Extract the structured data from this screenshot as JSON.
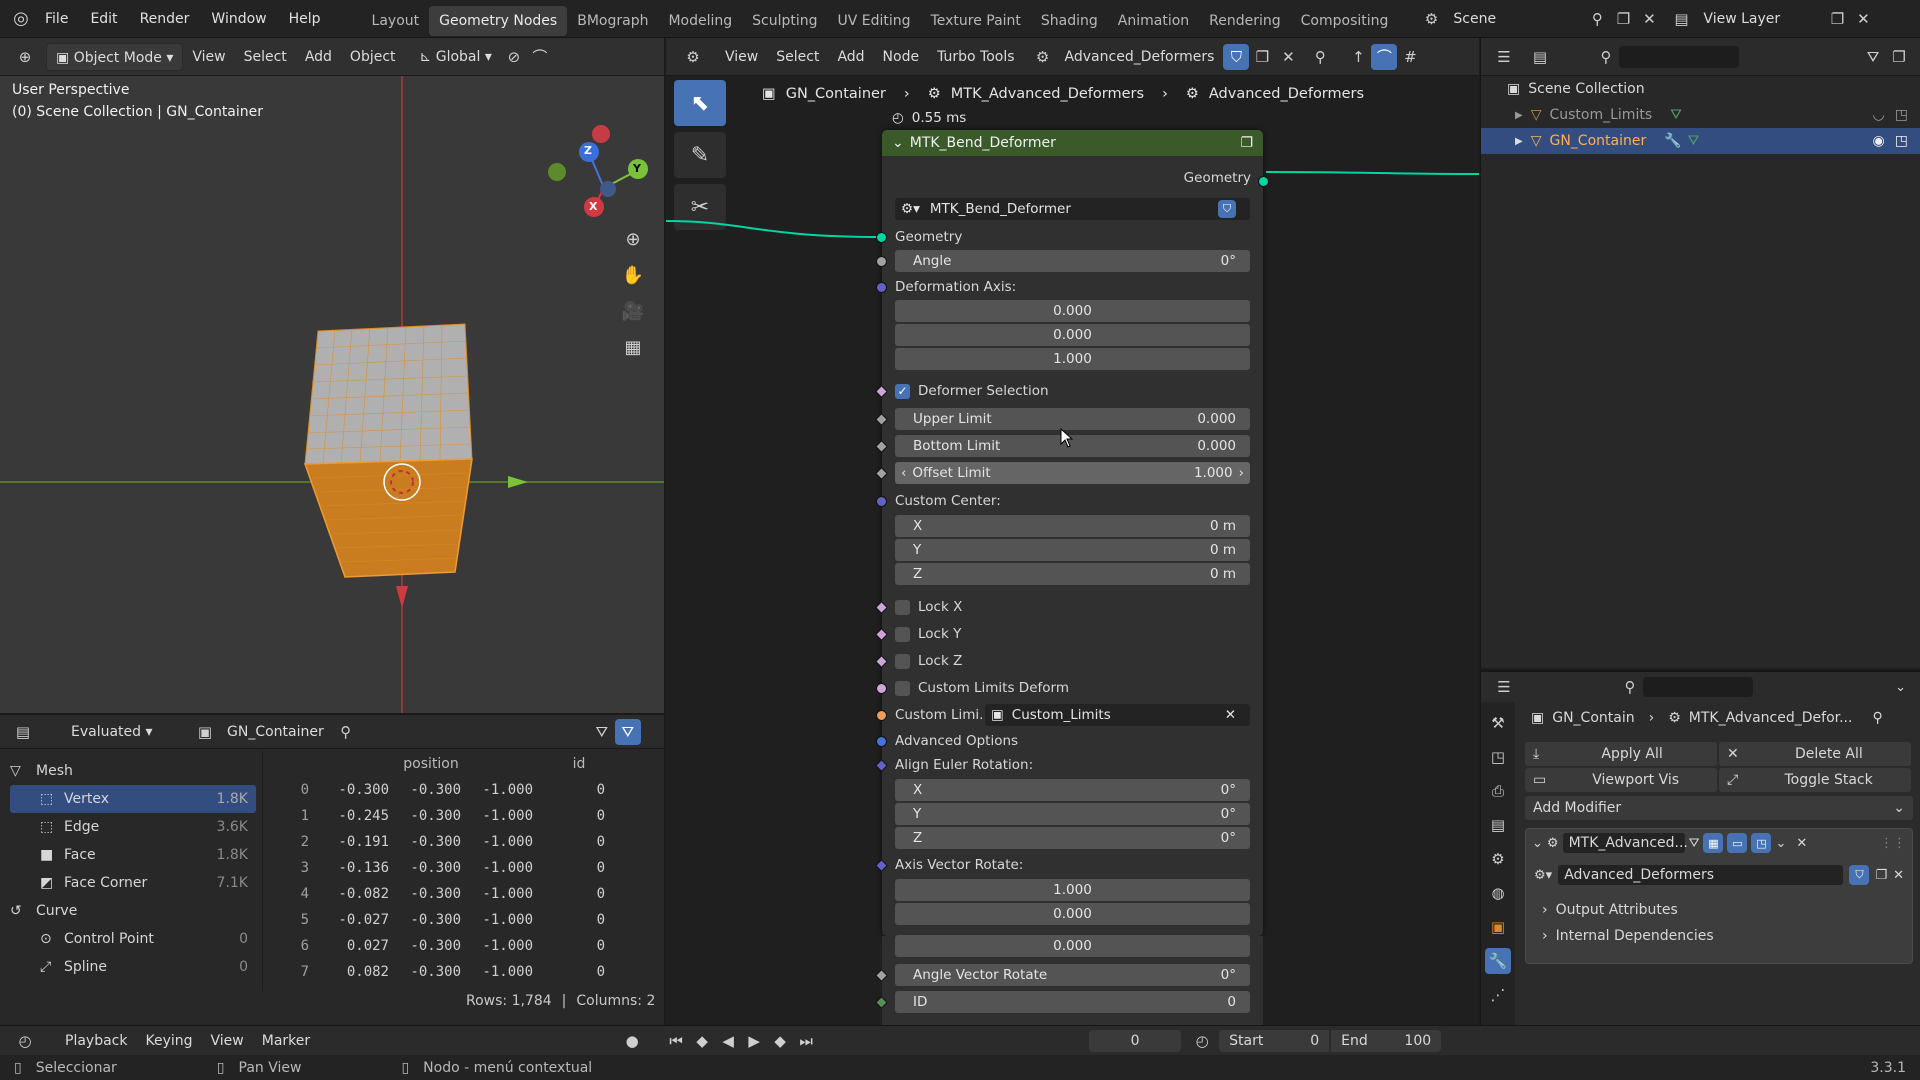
{
  "menu": [
    "File",
    "Edit",
    "Render",
    "Window",
    "Help"
  ],
  "workspaces": [
    "Layout",
    "Geometry Nodes",
    "BMograph",
    "Modeling",
    "Sculpting",
    "UV Editing",
    "Texture Paint",
    "Shading",
    "Animation",
    "Rendering",
    "Compositing"
  ],
  "active_workspace": "Geometry Nodes",
  "scene": "Scene",
  "view_layer": "View Layer",
  "viewport": {
    "mode": "Object Mode",
    "menus": [
      "View",
      "Select",
      "Add",
      "Object"
    ],
    "transform": "Global",
    "title": "User Perspective",
    "subtitle": "(0) Scene Collection | GN_Container",
    "axis_x": "X",
    "axis_y": "Y",
    "axis_z": "Z"
  },
  "node_editor": {
    "menus": [
      "View",
      "Select",
      "Add",
      "Node",
      "Turbo Tools"
    ],
    "node_group": "Advanced_Deformers",
    "breadcrumb": [
      "GN_Container",
      "MTK_Advanced_Deformers",
      "Advanced_Deformers"
    ],
    "timing": "0.55 ms",
    "node_title": "MTK_Bend_Deformer",
    "output_label": "Geometry",
    "group_name": "MTK_Bend_Deformer",
    "geometry": "Geometry",
    "angle_label": "Angle",
    "angle_value": "0°",
    "deform_axis_label": "Deformation Axis:",
    "deform_axis": [
      "0.000",
      "0.000",
      "1.000"
    ],
    "deformer_selection": "Deformer Selection",
    "upper_label": "Upper Limit",
    "upper_value": "0.000",
    "bottom_label": "Bottom Limit",
    "bottom_value": "0.000",
    "offset_label": "Offset Limit",
    "offset_value": "1.000",
    "center_label": "Custom Center:",
    "center": [
      {
        "k": "X",
        "v": "0 m"
      },
      {
        "k": "Y",
        "v": "0 m"
      },
      {
        "k": "Z",
        "v": "0 m"
      }
    ],
    "lock_x": "Lock X",
    "lock_y": "Lock Y",
    "lock_z": "Lock Z",
    "custom_limits_deform": "Custom Limits Deform",
    "custom_limits_label": "Custom Limi...",
    "custom_limits_value": "Custom_Limits",
    "advanced_options": "Advanced Options",
    "align_label": "Align Euler Rotation:",
    "align": [
      {
        "k": "X",
        "v": "0°"
      },
      {
        "k": "Y",
        "v": "0°"
      },
      {
        "k": "Z",
        "v": "0°"
      }
    ],
    "axis_rotate_label": "Axis Vector Rotate:",
    "axis_rotate": [
      "1.000",
      "0.000",
      "0.000"
    ],
    "angle_vector_label": "Angle Vector Rotate",
    "angle_vector_value": "0°",
    "id_label": "ID",
    "id_value": "0"
  },
  "spreadsheet": {
    "mode": "Evaluated",
    "object": "GN_Container",
    "col_position": "position",
    "col_id": "id",
    "tree": [
      {
        "label": "Mesh",
        "count": ""
      },
      {
        "label": "Vertex",
        "count": "1.8K"
      },
      {
        "label": "Edge",
        "count": "3.6K"
      },
      {
        "label": "Face",
        "count": "1.8K"
      },
      {
        "label": "Face Corner",
        "count": "7.1K"
      },
      {
        "label": "Curve",
        "count": ""
      },
      {
        "label": "Control Point",
        "count": "0"
      },
      {
        "label": "Spline",
        "count": "0"
      }
    ],
    "rows": [
      {
        "i": "0",
        "x": "-0.300",
        "y": "-0.300",
        "z": "-1.000",
        "id": "0"
      },
      {
        "i": "1",
        "x": "-0.245",
        "y": "-0.300",
        "z": "-1.000",
        "id": "0"
      },
      {
        "i": "2",
        "x": "-0.191",
        "y": "-0.300",
        "z": "-1.000",
        "id": "0"
      },
      {
        "i": "3",
        "x": "-0.136",
        "y": "-0.300",
        "z": "-1.000",
        "id": "0"
      },
      {
        "i": "4",
        "x": "-0.082",
        "y": "-0.300",
        "z": "-1.000",
        "id": "0"
      },
      {
        "i": "5",
        "x": "-0.027",
        "y": "-0.300",
        "z": "-1.000",
        "id": "0"
      },
      {
        "i": "6",
        "x": "0.027",
        "y": "-0.300",
        "z": "-1.000",
        "id": "0"
      },
      {
        "i": "7",
        "x": "0.082",
        "y": "-0.300",
        "z": "-1.000",
        "id": "0"
      }
    ],
    "footer_rows": "Rows: 1,784",
    "footer_cols": "Columns: 2"
  },
  "outliner": {
    "root": "Scene Collection",
    "items": [
      "Custom_Limits",
      "GN_Container"
    ]
  },
  "properties": {
    "breadcrumb": [
      "GN_Contain",
      "MTK_Advanced_Defor..."
    ],
    "apply_all": "Apply All",
    "delete_all": "Delete All",
    "viewport_vis": "Viewport Vis",
    "toggle_stack": "Toggle Stack",
    "add_modifier": "Add Modifier",
    "modifier_name": "MTK_Advanced...",
    "node_group": "Advanced_Deformers",
    "output_attributes": "Output Attributes",
    "internal_deps": "Internal Dependencies"
  },
  "timeline": {
    "menus": [
      "Playback",
      "Keying",
      "View",
      "Marker"
    ],
    "frame": "0",
    "start_label": "Start",
    "start": "0",
    "end_label": "End",
    "end": "100"
  },
  "status": {
    "select": "Seleccionar",
    "pan": "Pan View",
    "context": "Nodo - menú contextual",
    "version": "3.3.1"
  },
  "colors": {
    "accent": "#4772b3",
    "node_header": "#3a5a2a",
    "geometry_socket": "#00d6a3",
    "float_socket": "#a1a1a1",
    "vector_socket": "#6363c7",
    "object_socket": "#ed9e5c",
    "bool_socket": "#cca6d6",
    "int_socket": "#598c5c",
    "selection": "#334d80"
  }
}
